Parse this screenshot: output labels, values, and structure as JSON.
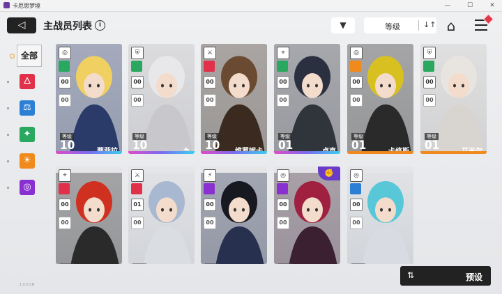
{
  "window": {
    "title": "卡厄思梦境",
    "minimize": "—",
    "maximize": "☐",
    "close": "✕"
  },
  "header": {
    "back_icon": "◁",
    "title": "主战员列表",
    "info_icon": "i",
    "filter_icon": "▼",
    "sort_label": "等级",
    "sort_icon": "↓↑",
    "home_icon": "⌂"
  },
  "sidebar": {
    "all_label": "全部",
    "items": [
      {
        "name": "passion",
        "glyph": "🜂",
        "color": "#e0304a"
      },
      {
        "name": "order",
        "glyph": "⚖",
        "color": "#2d7fd6"
      },
      {
        "name": "justice",
        "glyph": "✦",
        "color": "#2aa860"
      },
      {
        "name": "instinct",
        "glyph": "☀",
        "color": "#f08a1c"
      },
      {
        "name": "void",
        "glyph": "◎",
        "color": "#8a30d0"
      }
    ]
  },
  "cards": [
    {
      "name": "蒂菲拉",
      "level_label": "等级",
      "level": "10",
      "class_icon": "◎",
      "element": "justice",
      "c1": "00",
      "c2": "00",
      "bg": "#2a3b6a",
      "hair": "#f0d060",
      "bar": "rainbow"
    },
    {
      "name": "九",
      "level_label": "等级",
      "level": "10",
      "class_icon": "⛨",
      "element": "justice",
      "c1": "00",
      "c2": "00",
      "bg": "#c8c8cc",
      "hair": "#e8e8ea",
      "bar": "rainbow"
    },
    {
      "name": "维罗妮卡",
      "level_label": "等级",
      "level": "10",
      "class_icon": "⚔",
      "element": "passion",
      "c1": "00",
      "c2": "00",
      "bg": "#3a2a20",
      "hair": "#6a4a30",
      "bar": "rainbow"
    },
    {
      "name": "卢克",
      "level_label": "等级",
      "level": "01",
      "class_icon": "⌖",
      "element": "justice",
      "c1": "00",
      "c2": "00",
      "bg": "#30353c",
      "hair": "#2a3040",
      "bar": "rainbow"
    },
    {
      "name": "卡修斯",
      "level_label": "等级",
      "level": "01",
      "class_icon": "◎",
      "element": "instinct",
      "c1": "00",
      "c2": "00",
      "bg": "#2a2a2a",
      "hair": "#d8c020",
      "bar": "orange"
    },
    {
      "name": "艾米尔",
      "level_label": "等级",
      "level": "01",
      "class_icon": "⛨",
      "element": "justice",
      "c1": "00",
      "c2": "00",
      "bg": "#d8d4d0",
      "hair": "#e8e4e0",
      "bar": "orange"
    },
    {
      "name": "",
      "level_label": "等级",
      "level": "",
      "class_icon": "⌖",
      "element": "passion",
      "c1": "00",
      "c2": "00",
      "bg": "#2a2a2a",
      "hair": "#d03020",
      "bar": "none"
    },
    {
      "name": "",
      "level_label": "等级",
      "level": "",
      "class_icon": "⚔",
      "element": "passion",
      "c1": "01",
      "c2": "00",
      "bg": "#dadde2",
      "hair": "#a8b8d0",
      "bar": "none"
    },
    {
      "name": "",
      "level_label": "等级",
      "level": "",
      "class_icon": "⚡",
      "element": "void",
      "c1": "00",
      "c2": "00",
      "bg": "#283050",
      "hair": "#181820",
      "bar": "none"
    },
    {
      "name": "",
      "level_label": "等级",
      "level": "",
      "class_icon": "◎",
      "element": "void",
      "c1": "00",
      "c2": "00",
      "bg": "#3a2030",
      "hair": "#a02040",
      "bar": "none",
      "fist": "✊"
    },
    {
      "name": "",
      "level_label": "等级",
      "level": "",
      "class_icon": "◎",
      "element": "order",
      "c1": "00",
      "c2": "00",
      "bg": "#d8dce2",
      "hair": "#58c8d8",
      "bar": "none"
    }
  ],
  "preset": {
    "icon": "⇅",
    "label": "预设"
  },
  "footer": {
    "version": "1.0.0 CN"
  }
}
